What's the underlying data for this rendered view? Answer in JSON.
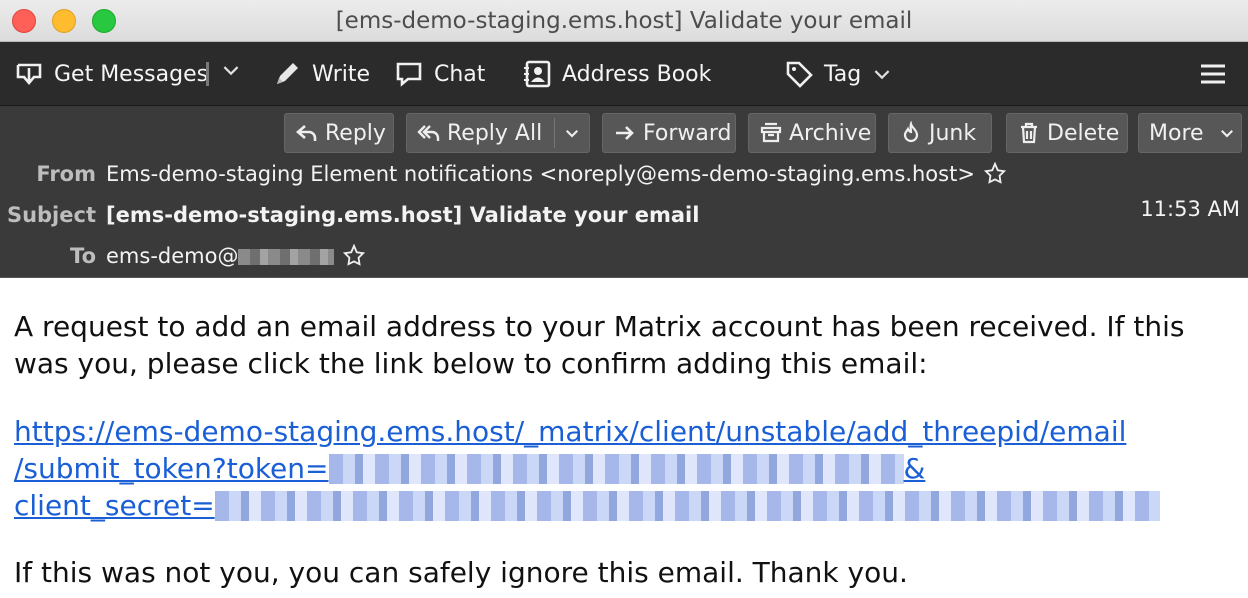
{
  "window": {
    "title": "[ems-demo-staging.ems.host] Validate your email"
  },
  "toolbar": {
    "get_messages": "Get Messages",
    "write": "Write",
    "chat": "Chat",
    "address_book": "Address Book",
    "tag": "Tag"
  },
  "actions": {
    "reply": "Reply",
    "reply_all": "Reply All",
    "forward": "Forward",
    "archive": "Archive",
    "junk": "Junk",
    "delete": "Delete",
    "more": "More"
  },
  "message": {
    "from_label": "From",
    "from_value": "Ems-demo-staging Element notifications <noreply@ems-demo-staging.ems.host>",
    "subject_label": "Subject",
    "subject_value": "[ems-demo-staging.ems.host] Validate your email",
    "to_label": "To",
    "to_value": "ems-demo@",
    "time": "11:53 AM"
  },
  "body": {
    "intro": "A request to add an email address to your Matrix account has been received. If this was you, please click the link below to confirm adding this email:",
    "link_line1": "https://ems-demo-staging.ems.host/_matrix/client/unstable/add_threepid/email",
    "link_line2_prefix": "/submit_token?token=",
    "link_line2_suffix": "&",
    "link_line3_prefix": "client_secret=",
    "outro": "If this was not you, you can safely ignore this email. Thank you."
  },
  "icons": {
    "get_messages": "download-tray-icon",
    "write": "pencil-icon",
    "chat": "chat-bubble-icon",
    "address_book": "address-book-icon",
    "tag": "tag-icon",
    "menu": "hamburger-icon"
  }
}
